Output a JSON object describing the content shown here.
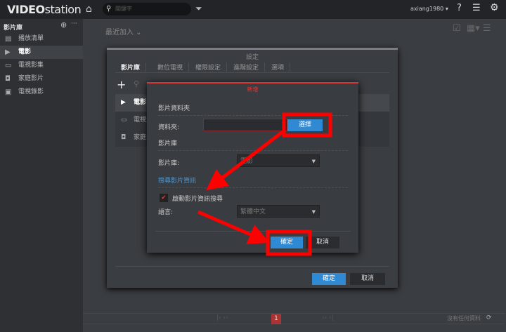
{
  "app": {
    "logo": "VIDEOstation",
    "search_placeholder": "關鍵字",
    "user": "axiang1980 ▾"
  },
  "sidebar": {
    "header": "影片庫",
    "items": [
      {
        "label": "播放清單",
        "icon": "playlist-icon"
      },
      {
        "label": "電影",
        "icon": "movie-icon",
        "active": true
      },
      {
        "label": "電視影集",
        "icon": "tv-icon"
      },
      {
        "label": "家庭影片",
        "icon": "camera-icon"
      },
      {
        "label": "電視錄影",
        "icon": "tv-record-icon"
      }
    ]
  },
  "main": {
    "sort": "最近加入 ⌄",
    "pager": {
      "current": "1",
      "status": "沒有任何資料"
    }
  },
  "settings": {
    "title": "設定",
    "tabs": [
      "影片庫",
      "數位電視",
      "權限設定",
      "進階設定",
      "選項"
    ],
    "rows": [
      "電影",
      "電視影集",
      "家庭影片"
    ],
    "ok": "確定",
    "cancel": "取消"
  },
  "dialog": {
    "title": "新增",
    "folder_section": "影片資料夾",
    "folder_label": "資料夾:",
    "folder_value": "",
    "choose": "選擇",
    "library_section": "影片庫",
    "library_label": "影片庫:",
    "library_value": "電影",
    "search_section": "搜尋影片資訊",
    "enable_label": "啟動影片資訊搜尋",
    "enable_checked": true,
    "language_label": "語言:",
    "language_value": "繁體中文",
    "ok": "確定",
    "cancel": "取消"
  },
  "annotation_color": "#ff0000"
}
